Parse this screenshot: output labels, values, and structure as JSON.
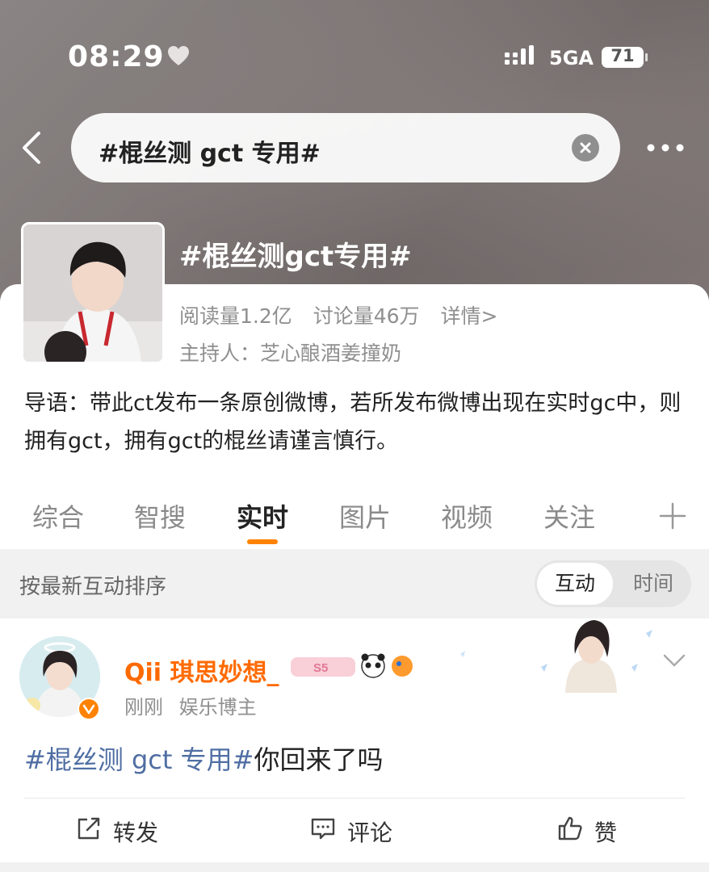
{
  "status_bar": {
    "time": "08:29",
    "network": "5GA",
    "battery": "71"
  },
  "search": {
    "query": "#棍丝测 gct 专用#"
  },
  "topic": {
    "title": "#棍丝测gct专用#",
    "read_count": "阅读量1.2亿",
    "discuss_count": "讨论量46万",
    "details_link": "详情>",
    "host": "主持人：芝心酿酒姜撞奶",
    "intro": "导语：带此ct发布一条原创微博，若所发布微博出现在实时gc中，则拥有gct，拥有gct的棍丝请谨言慎行。"
  },
  "tabs": [
    {
      "label": "综合"
    },
    {
      "label": "智搜"
    },
    {
      "label": "实时",
      "active": true
    },
    {
      "label": "图片"
    },
    {
      "label": "视频"
    },
    {
      "label": "关注"
    }
  ],
  "sort": {
    "label": "按最新互动排序",
    "options": [
      "互动",
      "时间"
    ],
    "selected": "互动"
  },
  "post": {
    "username": "Qii 琪思妙想_",
    "time": "刚刚",
    "role": "娱乐博主",
    "hashtag": "#棍丝测 gct 专用#",
    "text": "你回来了吗",
    "badge_level": "S5"
  },
  "actions": {
    "repost": "转发",
    "comment": "评论",
    "like": "赞"
  },
  "colors": {
    "accent": "#ff8200",
    "username": "#ff6a00",
    "hashtag": "#4f6ea3"
  },
  "icons": [
    "heart-icon",
    "signal-icon",
    "battery-icon",
    "back-icon",
    "clear-icon",
    "more-icon",
    "plus-icon",
    "chevron-down-icon",
    "repost-icon",
    "comment-icon",
    "like-icon"
  ]
}
